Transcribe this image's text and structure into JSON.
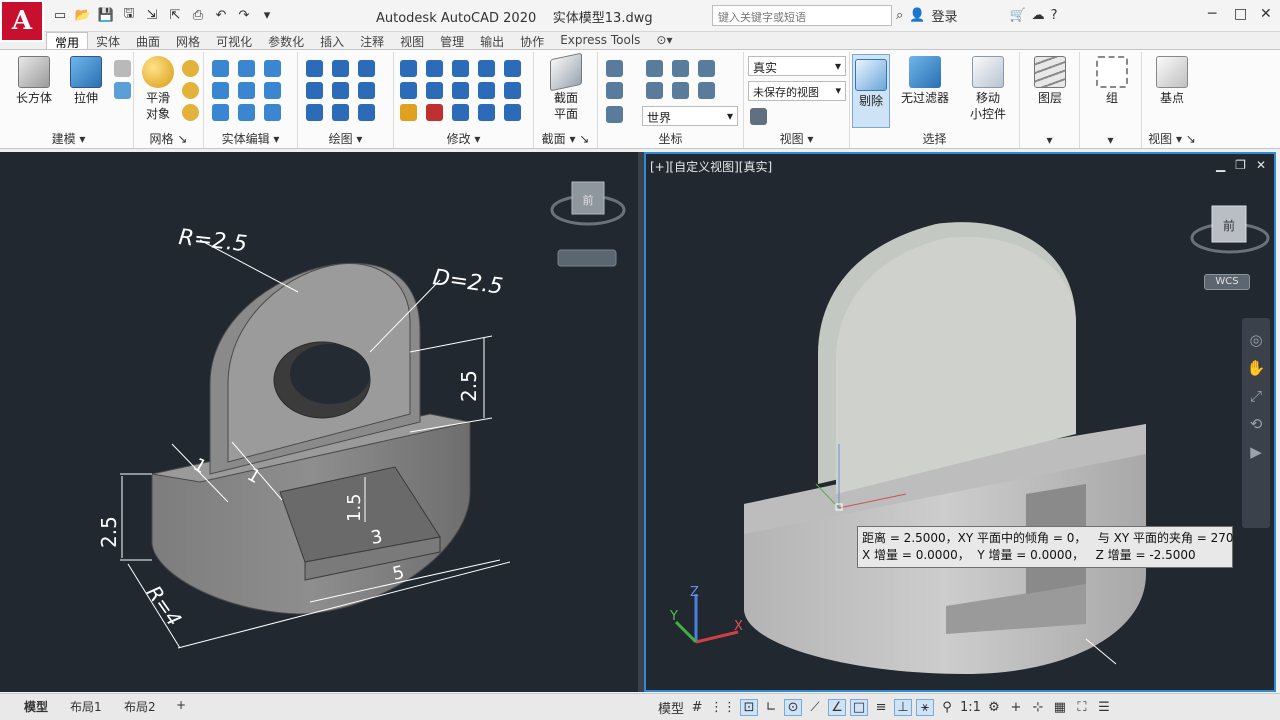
{
  "app": {
    "logo": "A",
    "title": "Autodesk AutoCAD 2020",
    "filename": "实体模型13.dwg"
  },
  "search": {
    "placeholder": "键入关键字或短语"
  },
  "user": {
    "login": "登录"
  },
  "tabs": [
    "常用",
    "实体",
    "曲面",
    "网格",
    "可视化",
    "参数化",
    "插入",
    "注释",
    "视图",
    "管理",
    "输出",
    "协作",
    "Express Tools"
  ],
  "active_tab": "常用",
  "ribbon": {
    "modeling": {
      "box": "长方体",
      "extrude": "拉伸",
      "label": "建模"
    },
    "mesh": {
      "smooth1": "平滑",
      "smooth2": "对象",
      "label": "网格"
    },
    "solid_edit": {
      "label": "实体编辑"
    },
    "draw": {
      "label": "绘图"
    },
    "modify": {
      "label": "修改"
    },
    "section": {
      "plane1": "截面",
      "plane2": "平面",
      "label": "截面"
    },
    "coords": {
      "world": "世界",
      "label": "坐标"
    },
    "view": {
      "visual_style": "真实",
      "saved_view": "未保存的视图",
      "label": "视图"
    },
    "cull": "剔除",
    "filter": "无过滤器",
    "gizmo1": "移动",
    "gizmo2": "小控件",
    "selection_label": "选择",
    "layers": "图层",
    "group": "组",
    "base": "基点",
    "view2": "视图"
  },
  "viewport_left": {
    "navcube_text": "前"
  },
  "viewport_right": {
    "label": "[+][自定义视图][真实]",
    "navcube_text": "前",
    "wcs": "WCS"
  },
  "dimensions": {
    "r1": "R=2.5",
    "d1": "D=2.5",
    "h1": "2.5",
    "h2": "2.5",
    "w1": "1",
    "w2": "1",
    "w3": "1.5",
    "w4": "3",
    "w5": "5",
    "r2": "R=4"
  },
  "tooltip": {
    "line1": "距离 = 2.5000，XY 平面中的倾角 = 0，   与 XY 平面的夹角 = 270",
    "line2": "X 增量 = 0.0000，  Y 增量 = 0.0000，   Z 增量 = -2.5000"
  },
  "layouts": [
    "模型",
    "布局1",
    "布局2"
  ],
  "status": {
    "model": "模型",
    "scale": "1:1"
  },
  "axis": {
    "x": "X",
    "y": "Y",
    "z": "Z"
  }
}
